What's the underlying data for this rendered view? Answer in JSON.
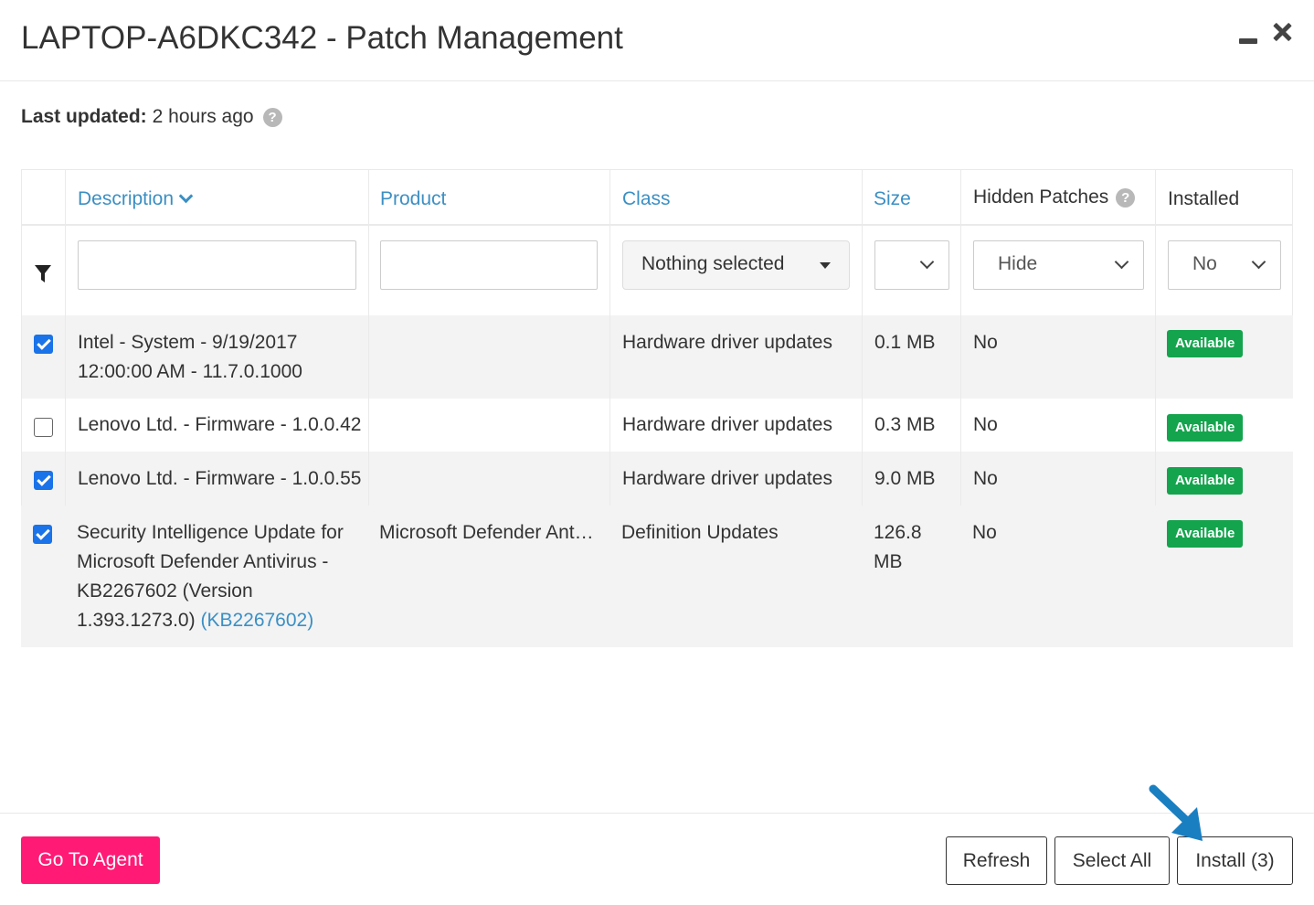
{
  "window": {
    "title": "LAPTOP-A6DKC342 - Patch Management"
  },
  "status": {
    "last_updated_label": "Last updated:",
    "last_updated_value": "2 hours ago"
  },
  "table": {
    "columns": {
      "description": "Description",
      "product": "Product",
      "class": "Class",
      "size": "Size",
      "hidden_patches": "Hidden Patches",
      "installed": "Installed"
    },
    "filters": {
      "description": "",
      "product": "",
      "class": "Nothing selected",
      "size": "",
      "hidden_patches": "Hide",
      "installed": "No"
    },
    "rows": [
      {
        "checked": true,
        "description_line1": "Intel - System - 9/19/2017",
        "description_line2": "12:00:00 AM - 11.7.0.1000",
        "product": "",
        "class": "Hardware driver updates",
        "size": "0.1 MB",
        "hidden": "No",
        "installed": "Available"
      },
      {
        "checked": false,
        "description": "Lenovo Ltd. - Firmware - 1.0.0.42",
        "product": "",
        "class": "Hardware driver updates",
        "size": "0.3 MB",
        "hidden": "No",
        "installed": "Available"
      },
      {
        "checked": true,
        "description": "Lenovo Ltd. - Firmware - 1.0.0.55",
        "product": "",
        "class": "Hardware driver updates",
        "size": "9.0 MB",
        "hidden": "No",
        "installed": "Available"
      },
      {
        "checked": true,
        "description_line1": "Security Intelligence Update for",
        "description_line2": "Microsoft Defender Antivirus -",
        "description_line3": "KB2267602 (Version",
        "description_line4": "1.393.1273.0)",
        "kb_link": "(KB2267602)",
        "product": "Microsoft Defender Ant…",
        "class": "Definition Updates",
        "size_line1": "126.8",
        "size_line2": "MB",
        "hidden": "No",
        "installed": "Available"
      }
    ]
  },
  "footer": {
    "go_to_agent": "Go To Agent",
    "refresh": "Refresh",
    "select_all": "Select All",
    "install": "Install (3)"
  },
  "colors": {
    "link": "#3b8fc4",
    "accent_pink": "#ff1a75",
    "badge_green": "#14a44d",
    "checkbox_blue": "#1a73e8",
    "annotation_arrow": "#1a7fc1"
  }
}
